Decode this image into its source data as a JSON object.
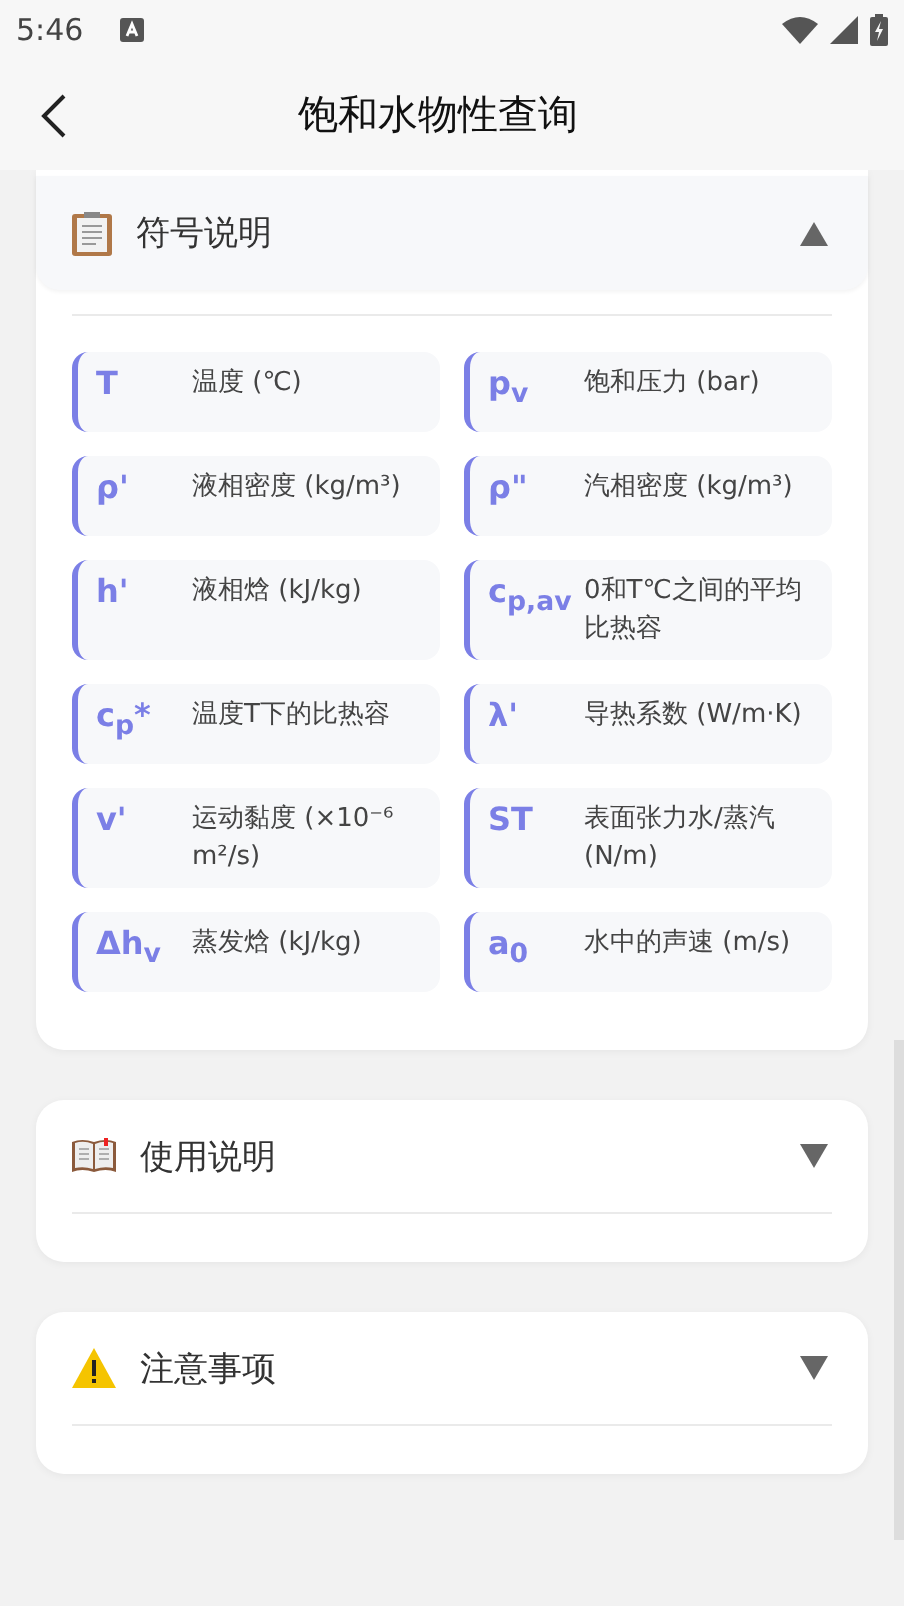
{
  "status_bar": {
    "time": "5:46"
  },
  "header": {
    "title": "饱和水物性查询"
  },
  "sections": [
    {
      "title": "符号说明",
      "kind": "clipboard",
      "expanded": true,
      "symbols": [
        {
          "symbol": "T",
          "desc": "温度 (℃)"
        },
        {
          "symbol": "p$_{v}$",
          "desc": "饱和压力 (bar)"
        },
        {
          "symbol": "ρ'",
          "desc": "液相密度 (kg/m³)"
        },
        {
          "symbol": "ρ\"",
          "desc": "汽相密度 (kg/m³)"
        },
        {
          "symbol": "h'",
          "desc": "液相焓 (kJ/kg)"
        },
        {
          "symbol": "c$_{p,av}$",
          "desc": "0和T℃之间的平均比热容"
        },
        {
          "symbol": "c$_{p}$*",
          "desc": "温度T下的比热容"
        },
        {
          "symbol": "λ'",
          "desc": "导热系数 (W/m·K)"
        },
        {
          "symbol": "v'",
          "desc": "运动黏度 (×10⁻⁶ m²/s)"
        },
        {
          "symbol": "ST",
          "desc": "表面张力水/蒸汽 (N/m)"
        },
        {
          "symbol": "Δh$_{v}$",
          "desc": "蒸发焓 (kJ/kg)"
        },
        {
          "symbol": "a$_{0}$",
          "desc": "水中的声速 (m/s)"
        }
      ]
    },
    {
      "title": "使用说明",
      "kind": "book",
      "expanded": false
    },
    {
      "title": "注意事项",
      "kind": "warning",
      "expanded": false
    }
  ]
}
